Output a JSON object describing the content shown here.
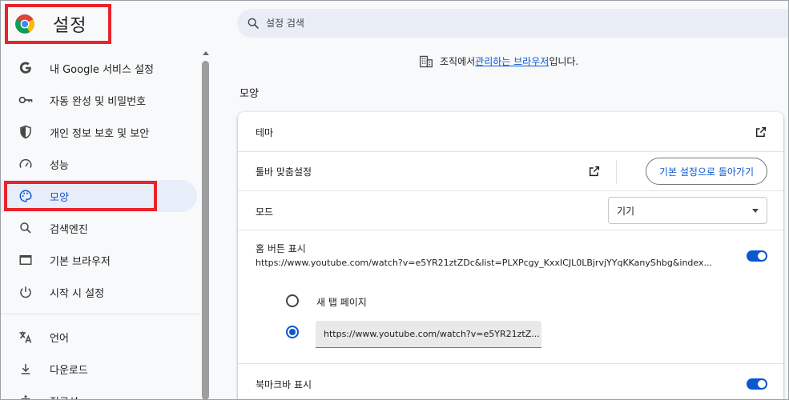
{
  "app": {
    "title": "설정"
  },
  "search": {
    "placeholder": "설정 검색"
  },
  "sidebar": {
    "items": [
      {
        "label": "내 Google 서비스 설정",
        "icon": "google-g-icon"
      },
      {
        "label": "자동 완성 및 비밀번호",
        "icon": "key-icon"
      },
      {
        "label": "개인 정보 보호 및 보안",
        "icon": "shield-icon"
      },
      {
        "label": "성능",
        "icon": "speedometer-icon"
      },
      {
        "label": "모양",
        "icon": "palette-icon"
      },
      {
        "label": "검색엔진",
        "icon": "search-icon"
      },
      {
        "label": "기본 브라우저",
        "icon": "browser-window-icon"
      },
      {
        "label": "시작 시 설정",
        "icon": "power-icon"
      },
      {
        "label": "언어",
        "icon": "translate-icon"
      },
      {
        "label": "다운로드",
        "icon": "download-icon"
      },
      {
        "label": "접근성",
        "icon": "accessibility-icon"
      }
    ]
  },
  "managed": {
    "prefix": "조직에서 ",
    "link": "관리하는 브라우저",
    "suffix": "입니다."
  },
  "appearance": {
    "title": "모양",
    "theme_label": "테마",
    "toolbar_label": "툴바 맞춤설정",
    "reset_button": "기본 설정으로 돌아가기",
    "mode_label": "모드",
    "mode_value": "기기",
    "home_label": "홈 버튼 표시",
    "home_url": "https://www.youtube.com/watch?v=e5YR21ztZDc&list=PLXPcgy_KxxICJL0LBjrvjYYqKKanyShbg&index...",
    "home_enabled": true,
    "radio_new_tab": "새 탭 페이지",
    "radio_custom_value": "https://www.youtube.com/watch?v=e5YR21ztZ...",
    "bookmarks_label": "북마크바 표시",
    "bookmarks_enabled": true
  },
  "colors": {
    "accent": "#0b57d0",
    "highlight": "#e8232a",
    "active_bg": "#e8eef9"
  }
}
